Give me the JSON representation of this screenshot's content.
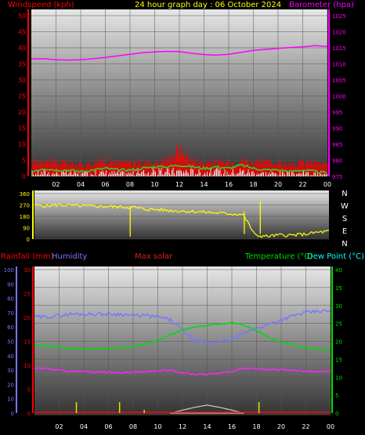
{
  "header": {
    "left_label": "Windspeed (kph)",
    "center_label": "24 hour graph day : 06 October 2024",
    "right_label": "Barometer (hpa)"
  },
  "colors": {
    "wind": "#ff0000",
    "wind_gust": "#ff2020",
    "wind_avg": "#22dd22",
    "wind_low": "#ffffff",
    "barometer": "#ff00ff",
    "direction": "#ffff00",
    "humidity": "#7777ff",
    "temperature": "#00dd00",
    "dewpoint": "#00ffff",
    "dewpoint_line": "#ff22ff",
    "rainfall": "#ff0000",
    "solar_label": "#dd2222",
    "solar_curve": "#cccccc",
    "rain_bars": "#eedd00"
  },
  "hours": [
    "02",
    "04",
    "06",
    "08",
    "10",
    "12",
    "14",
    "16",
    "18",
    "20",
    "22",
    "00"
  ],
  "chart_data": [
    {
      "type": "line",
      "panel": "wind",
      "ylabel_left": "Windspeed (kph)",
      "ylabel_right": "Barometer (hpa)",
      "y_left_ticks": [
        "0",
        "5",
        "10",
        "15",
        "20",
        "25",
        "30",
        "35",
        "40",
        "45",
        "50"
      ],
      "y_right_ticks": [
        "975",
        "980",
        "985",
        "990",
        "995",
        "1000",
        "1005",
        "1010",
        "1015",
        "1020",
        "1025"
      ],
      "ylim_left": [
        0,
        50
      ],
      "ylim_right": [
        975,
        1025
      ],
      "x_hours": [
        0,
        1,
        2,
        3,
        4,
        5,
        6,
        7,
        8,
        9,
        10,
        11,
        12,
        13,
        14,
        15,
        16,
        17,
        18,
        19,
        20,
        21,
        22,
        23,
        24
      ],
      "series": [
        {
          "key": "barometer",
          "axis": "right",
          "values": [
            1011.5,
            1011.6,
            1011.3,
            1011.2,
            1011.3,
            1011.6,
            1012.0,
            1012.5,
            1013.0,
            1013.5,
            1013.7,
            1013.9,
            1013.8,
            1013.3,
            1012.9,
            1012.7,
            1013.0,
            1013.6,
            1014.2,
            1014.5,
            1014.8,
            1015.1,
            1015.3,
            1015.7,
            1015.4
          ]
        },
        {
          "key": "wind_gust",
          "axis": "left",
          "values": [
            5,
            6,
            5,
            5,
            4,
            5,
            6,
            5,
            5,
            5,
            5,
            6,
            10,
            6,
            5,
            5,
            5,
            6,
            5,
            5,
            5,
            4,
            5,
            5,
            4
          ]
        },
        {
          "key": "wind_avg",
          "axis": "left",
          "values": [
            1.5,
            2.5,
            2,
            2,
            1.5,
            2,
            2.5,
            2,
            2,
            2.5,
            3,
            3,
            3.5,
            3,
            2.5,
            3,
            2.5,
            3.5,
            2.5,
            2,
            2,
            1.5,
            2,
            1.5,
            1
          ]
        }
      ]
    },
    {
      "type": "scatter",
      "panel": "direction",
      "y_left_ticks": [
        "0",
        "90",
        "180",
        "270",
        "360"
      ],
      "y_right_labels": [
        "N",
        "W",
        "S",
        "E",
        "N"
      ],
      "ylim": [
        0,
        360
      ],
      "series": [
        {
          "key": "direction",
          "x_hours": [
            0,
            1,
            2,
            3,
            4,
            5,
            6,
            7,
            8,
            9,
            10,
            11,
            12,
            13,
            14,
            15,
            16,
            17,
            18,
            19,
            20,
            21,
            22,
            23,
            24
          ],
          "values": [
            268,
            262,
            272,
            266,
            262,
            260,
            258,
            255,
            252,
            236,
            234,
            226,
            222,
            218,
            212,
            206,
            200,
            195,
            28,
            22,
            32,
            30,
            38,
            52,
            62
          ]
        }
      ],
      "spikes": [
        {
          "hour": 7.8,
          "from": 260,
          "to": 20
        },
        {
          "hour": 17.1,
          "from": 220,
          "to": 40
        },
        {
          "hour": 18.4,
          "from": 40,
          "to": 300
        }
      ]
    },
    {
      "type": "line",
      "panel": "atmosphere",
      "legend": [
        "Rainfall (mm)",
        "Humidity",
        "Max solar",
        "Temperature (°C)",
        "Dew Point (°C)"
      ],
      "y_humidity_ticks": [
        "0",
        "10",
        "20",
        "30",
        "40",
        "50",
        "60",
        "70",
        "80",
        "90",
        "100"
      ],
      "y_rain_ticks": [
        "0",
        "5",
        "10",
        "15",
        "20",
        "25",
        "30"
      ],
      "y_temp_ticks": [
        "0",
        "5",
        "10",
        "15",
        "20",
        "25",
        "30",
        "35",
        "40"
      ],
      "ylim_temp": [
        0,
        40
      ],
      "ylim_humidity": [
        0,
        100
      ],
      "x_hours": [
        0,
        1,
        2,
        3,
        4,
        5,
        6,
        7,
        8,
        9,
        10,
        11,
        12,
        13,
        14,
        15,
        16,
        17,
        18,
        19,
        20,
        21,
        22,
        23,
        24
      ],
      "series": [
        {
          "key": "humidity",
          "axis": "humidity",
          "values": [
            67,
            67,
            68,
            69,
            69,
            69,
            69,
            69,
            68,
            68,
            67,
            65,
            58,
            50,
            49,
            50,
            51,
            56,
            59,
            62,
            65,
            68,
            70,
            71,
            71
          ]
        },
        {
          "key": "temperature",
          "axis": "temp",
          "values": [
            19.0,
            18.8,
            18.4,
            18.0,
            17.9,
            17.9,
            18.0,
            18.2,
            18.6,
            19.2,
            20.2,
            21.8,
            23.3,
            24.0,
            24.4,
            24.8,
            25.2,
            24.6,
            23.0,
            21.0,
            19.8,
            19.0,
            18.2,
            17.8,
            17.7
          ]
        },
        {
          "key": "dewpoint_line",
          "axis": "temp",
          "values": [
            12.5,
            12.4,
            12.0,
            11.6,
            11.5,
            11.4,
            11.3,
            11.2,
            11.3,
            11.5,
            11.8,
            11.9,
            11.2,
            10.8,
            10.8,
            11.2,
            11.5,
            12.6,
            12.4,
            12.2,
            12.0,
            11.9,
            11.7,
            11.6,
            11.4
          ]
        },
        {
          "key": "solar",
          "axis": "humidity",
          "values": [
            0,
            0,
            0,
            0,
            0,
            0,
            0,
            0,
            0,
            0,
            0,
            0,
            2,
            4,
            5.5,
            4,
            2,
            0,
            0,
            0,
            0,
            0,
            0,
            0,
            0
          ]
        }
      ],
      "rain_ticks_hours": [
        3.4,
        6.9,
        8.9,
        18.2
      ]
    }
  ],
  "panel2_header": {
    "rainfall": "Rainfall (mm)",
    "humidity": "Humidity",
    "max_solar": "Max solar",
    "temperature": "Temperature (°C)",
    "dewpoint": "Dew Point (°C)"
  }
}
